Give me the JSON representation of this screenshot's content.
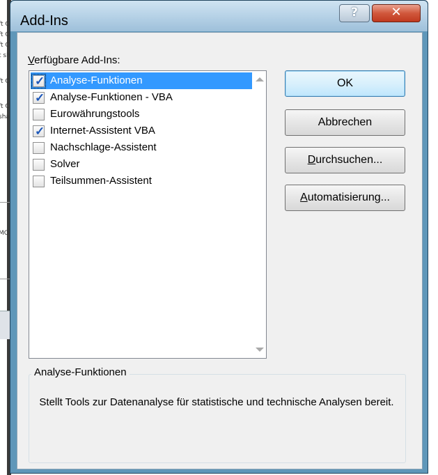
{
  "background": {
    "fragments": [
      "ft C",
      "ft C",
      "ft C",
      "t sh",
      "ft C",
      "ft C",
      "sha",
      "MO"
    ]
  },
  "dialog": {
    "title": "Add-Ins",
    "help_glyph": "?",
    "close_glyph": "✕"
  },
  "list": {
    "label_prefix": "V",
    "label_rest": "erfügbare Add-Ins:",
    "items": [
      {
        "label": "Analyse-Funktionen",
        "checked": true,
        "selected": true
      },
      {
        "label": "Analyse-Funktionen - VBA",
        "checked": true,
        "selected": false
      },
      {
        "label": "Eurowährungstools",
        "checked": false,
        "selected": false
      },
      {
        "label": "Internet-Assistent VBA",
        "checked": true,
        "selected": false
      },
      {
        "label": "Nachschlage-Assistent",
        "checked": false,
        "selected": false
      },
      {
        "label": "Solver",
        "checked": false,
        "selected": false
      },
      {
        "label": "Teilsummen-Assistent",
        "checked": false,
        "selected": false
      }
    ]
  },
  "buttons": {
    "ok": "OK",
    "cancel": "Abbrechen",
    "browse_mn": "D",
    "browse_rest": "urchsuchen...",
    "auto_mn": "A",
    "auto_rest": "utomatisierung..."
  },
  "description": {
    "title": "Analyse-Funktionen",
    "text": "Stellt Tools zur Datenanalyse für statistische und technische Analysen bereit."
  },
  "colors": {
    "selection": "#3399ff",
    "check": "#1c57b9",
    "frame": "#5f97b9"
  }
}
